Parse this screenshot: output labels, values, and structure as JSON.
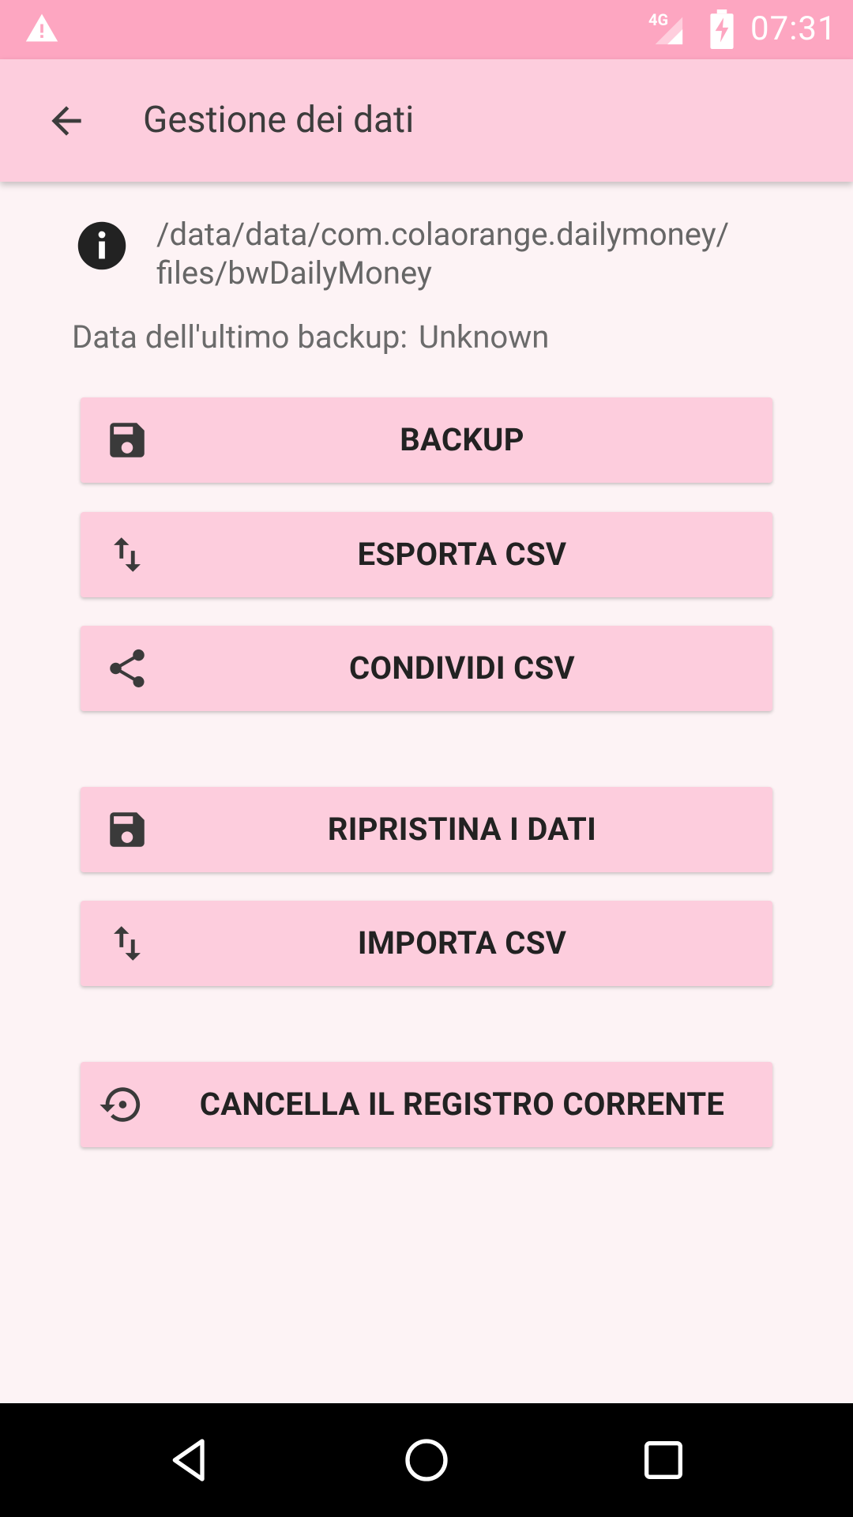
{
  "status_bar": {
    "time": "07:31",
    "network": "4G",
    "icons": [
      "warning-icon",
      "signal-icon",
      "battery-charging-icon"
    ]
  },
  "app_bar": {
    "title": "Gestione dei dati",
    "back_icon": "arrow-back-icon"
  },
  "info": {
    "path_line1": "/data/data/com.colaorange.dailymoney/",
    "path_line2": "files/bwDailyMoney",
    "icon": "info-icon"
  },
  "backup": {
    "label": "Data dell'ultimo backup:",
    "value": "Unknown"
  },
  "buttons": [
    {
      "label": "BACKUP",
      "icon": "save-icon"
    },
    {
      "label": "ESPORTA CSV",
      "icon": "swap-vert-icon"
    },
    {
      "label": "CONDIVIDI CSV",
      "icon": "share-icon"
    },
    {
      "label": "RIPRISTINA I DATI",
      "icon": "save-icon"
    },
    {
      "label": "IMPORTA CSV",
      "icon": "swap-vert-icon"
    },
    {
      "label": "CANCELLA IL REGISTRO CORRENTE",
      "icon": "restore-icon"
    }
  ],
  "nav_bar": {
    "icons": [
      "back-triangle-icon",
      "home-circle-icon",
      "recents-square-icon"
    ]
  },
  "colors": {
    "status_bar": "#fda6c1",
    "app_bar": "#fdcddd",
    "background": "#fdf3f5",
    "button": "#fdcddd",
    "icon": "#3a3a3a"
  }
}
